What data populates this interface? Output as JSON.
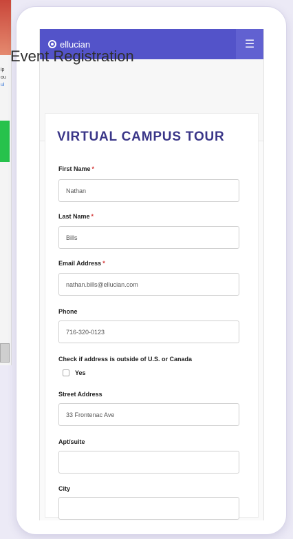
{
  "background": {
    "text_lines": [
      "ip",
      "ou",
      "ul"
    ]
  },
  "brand": {
    "logo_text": "ellucian"
  },
  "icons": {
    "menu": "hamburger-icon"
  },
  "page": {
    "title": "Event Registration"
  },
  "event": {
    "title": "VIRTUAL CAMPUS TOUR"
  },
  "form": {
    "required_marker": "*",
    "fields": [
      {
        "label": "First Name",
        "required": true,
        "value": "Nathan"
      },
      {
        "label": "Last Name",
        "required": true,
        "value": "Bills"
      },
      {
        "label": "Email Address",
        "required": true,
        "value": "nathan.bills@ellucian.com"
      },
      {
        "label": "Phone",
        "required": false,
        "value": "716-320-0123"
      },
      {
        "label": "Street Address",
        "required": false,
        "value": "33 Frontenac Ave"
      },
      {
        "label": "Apt/suite",
        "required": false,
        "value": ""
      },
      {
        "label": "City",
        "required": false,
        "value": ""
      }
    ],
    "outside_us_question": "Check if address is outside of U.S. or Canada",
    "outside_us_option": "Yes"
  },
  "colors": {
    "brand_bar": "#5353c9",
    "event_title": "#3a3688",
    "required": "#d43a3a"
  }
}
